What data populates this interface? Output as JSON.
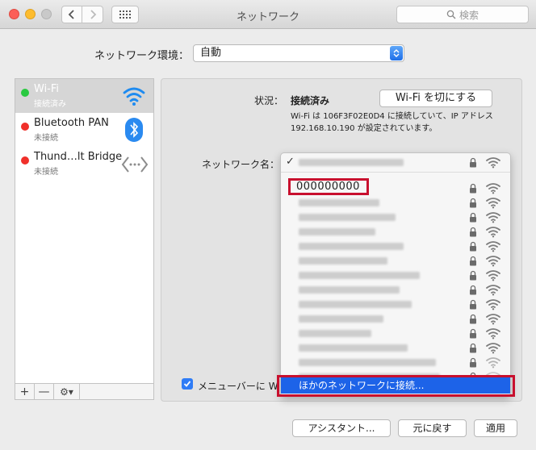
{
  "window": {
    "title": "ネットワーク"
  },
  "search": {
    "placeholder": "検索"
  },
  "location": {
    "label": "ネットワーク環境：",
    "value": "自動"
  },
  "services": [
    {
      "name": "Wi-Fi",
      "status": "接続済み",
      "status_color": "#29c940",
      "icon": "wifi-icon"
    },
    {
      "name": "Bluetooth PAN",
      "status": "未接続",
      "status_color": "#f0302a",
      "icon": "bluetooth-icon"
    },
    {
      "name": "Thund…lt Bridge",
      "status": "未接続",
      "status_color": "#f0302a",
      "icon": "thunderbolt-bridge-icon"
    }
  ],
  "service_toolbar": {
    "add": "+",
    "remove": "—",
    "gear": "⚙▾"
  },
  "detail": {
    "status_label": "状況：",
    "status_value": "接続済み",
    "wifi_off_button": "Wi-Fi を切にする",
    "description": "Wi-Fi は 106F3F02E0D4 に接続していて、IP アドレス 192.168.10.190 が設定されています。",
    "network_name_label": "ネットワーク名：",
    "menubar_label": "メニューバーに W"
  },
  "dropdown": {
    "highlighted_network": "000000000",
    "other_network": "ほかのネットワークに接続..."
  },
  "buttons": {
    "assistant": "アシスタント...",
    "revert": "元に戻す",
    "apply": "適用"
  },
  "colors": {
    "accent": "#1d63e8",
    "highlight_border": "#c8102e",
    "connected": "#29c940",
    "disconnected": "#f0302a"
  }
}
